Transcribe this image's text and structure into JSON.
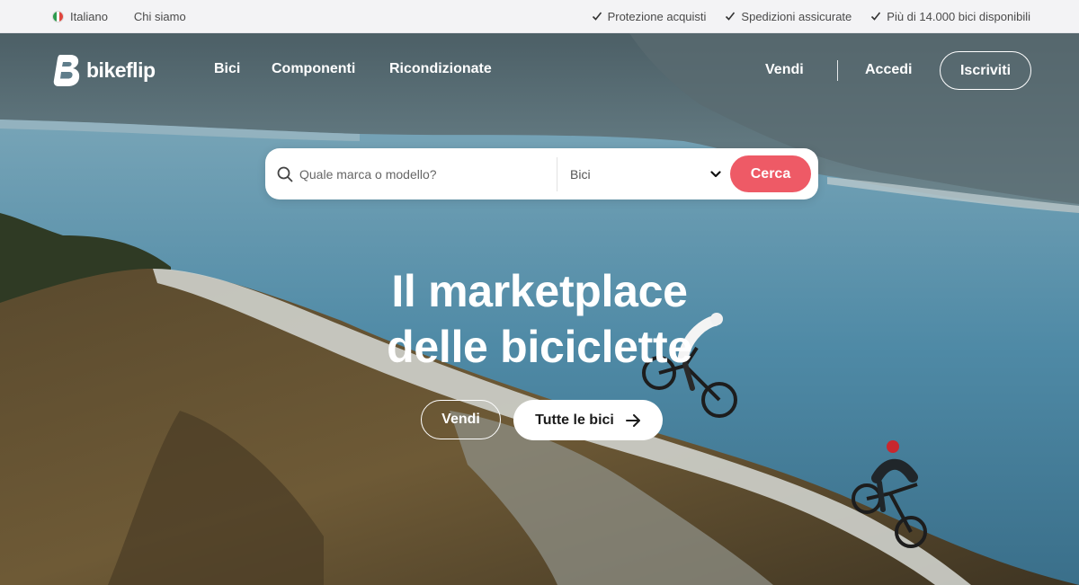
{
  "topbar": {
    "language": "Italiano",
    "about": "Chi siamo",
    "usps": [
      "Protezione acquisti",
      "Spedizioni assicurate",
      "Più di 14.000 bici disponibili"
    ]
  },
  "brand": {
    "name": "bikeflip",
    "accent": "#ee5a66"
  },
  "nav": {
    "links": [
      "Bici",
      "Componenti",
      "Ricondizionate"
    ],
    "sell": "Vendi",
    "login": "Accedi",
    "signup": "Iscriviti"
  },
  "search": {
    "placeholder": "Quale marca o modello?",
    "category": "Bici",
    "button": "Cerca"
  },
  "hero": {
    "headline_line1": "Il marketplace",
    "headline_line2": "delle biciclette",
    "cta_sell": "Vendi",
    "cta_all": "Tutte le bici"
  },
  "icons": {
    "flag": "italy-flag-icon",
    "check": "check-icon",
    "logo": "bikeflip-logo-icon",
    "search": "search-icon",
    "chevron": "chevron-down-icon",
    "arrow": "arrow-right-icon"
  }
}
